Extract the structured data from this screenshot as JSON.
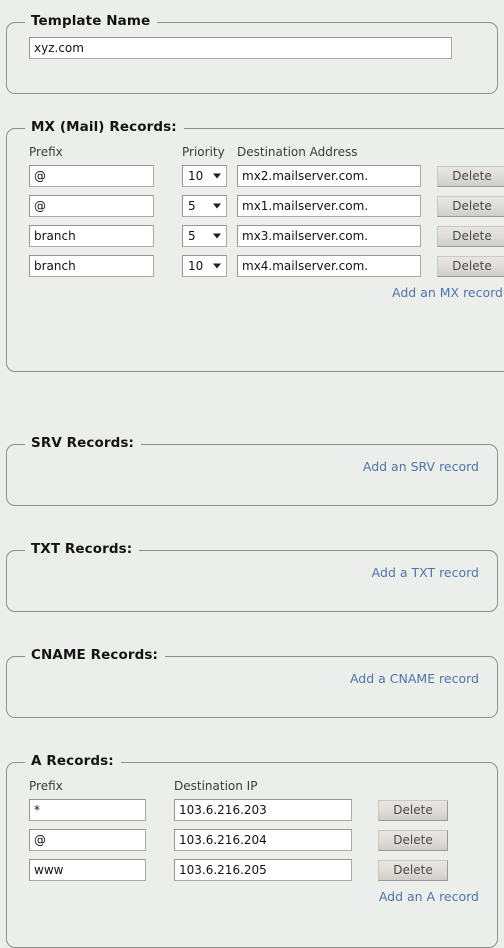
{
  "colors": {
    "page_background": "#eceeeb",
    "section_border": "#8e908d",
    "link": "#4e76a9",
    "text": "#141414",
    "button_face": "#dedcd7"
  },
  "template_section": {
    "legend": "Template Name",
    "name_input": {
      "value": "xyz.com",
      "placeholder": ""
    }
  },
  "mx_section": {
    "legend": "MX (Mail) Records:",
    "headers": {
      "prefix": "Prefix",
      "priority": "Priority",
      "destination": "Destination Address"
    },
    "delete_label": "Delete",
    "add_link": "Add an MX record",
    "rows": [
      {
        "prefix": "@",
        "priority": "10",
        "destination": "mx2.mailserver.com."
      },
      {
        "prefix": "@",
        "priority": "5",
        "destination": "mx1.mailserver.com."
      },
      {
        "prefix": "branch",
        "priority": "5",
        "destination": "mx3.mailserver.com."
      },
      {
        "prefix": "branch",
        "priority": "10",
        "destination": "mx4.mailserver.com."
      }
    ]
  },
  "srv_section": {
    "legend": "SRV Records:",
    "add_link": "Add an SRV record",
    "rows": []
  },
  "txt_section": {
    "legend": "TXT Records:",
    "add_link": "Add a TXT record",
    "rows": []
  },
  "cname_section": {
    "legend": "CNAME Records:",
    "add_link": "Add a CNAME record",
    "rows": []
  },
  "a_section": {
    "legend": "A Records:",
    "headers": {
      "prefix": "Prefix",
      "destination": "Destination IP"
    },
    "delete_label": "Delete",
    "add_link": "Add an A record",
    "rows": [
      {
        "prefix": "*",
        "destination": "103.6.216.203"
      },
      {
        "prefix": "@",
        "destination": "103.6.216.204"
      },
      {
        "prefix": "www",
        "destination": "103.6.216.205"
      }
    ]
  }
}
